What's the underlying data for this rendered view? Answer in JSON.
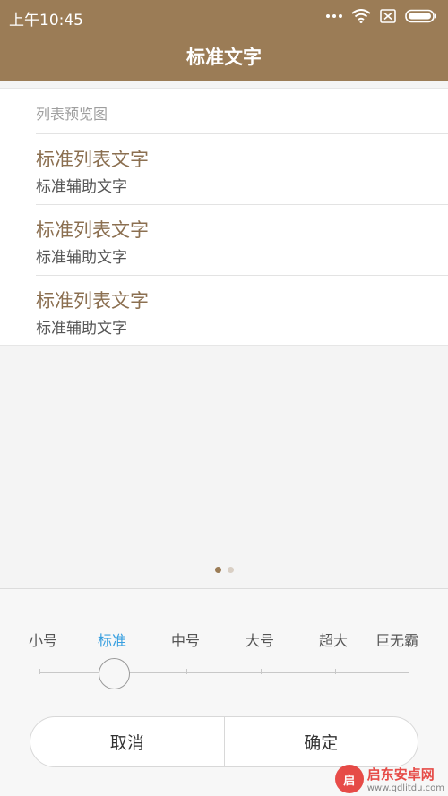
{
  "status_bar": {
    "time": "上午10:45"
  },
  "header": {
    "title": "标准文字"
  },
  "preview": {
    "section_label": "列表预览图",
    "items": [
      {
        "title": "标准列表文字",
        "subtitle": "标准辅助文字"
      },
      {
        "title": "标准列表文字",
        "subtitle": "标准辅助文字"
      },
      {
        "title": "标准列表文字",
        "subtitle": "标准辅助文字"
      }
    ]
  },
  "pager": {
    "pages": 2,
    "current": 1
  },
  "font_size": {
    "options": [
      "小号",
      "标准",
      "中号",
      "大号",
      "超大",
      "巨无霸"
    ],
    "selected": "标准"
  },
  "actions": {
    "cancel": "取消",
    "confirm": "确定"
  },
  "watermark": {
    "logo": "启",
    "name": "启东安卓网",
    "url": "www.qdlitdu.com"
  },
  "colors": {
    "header": "#9b7c56",
    "accent": "#3aa0e0",
    "item_title": "#8b6f50"
  }
}
